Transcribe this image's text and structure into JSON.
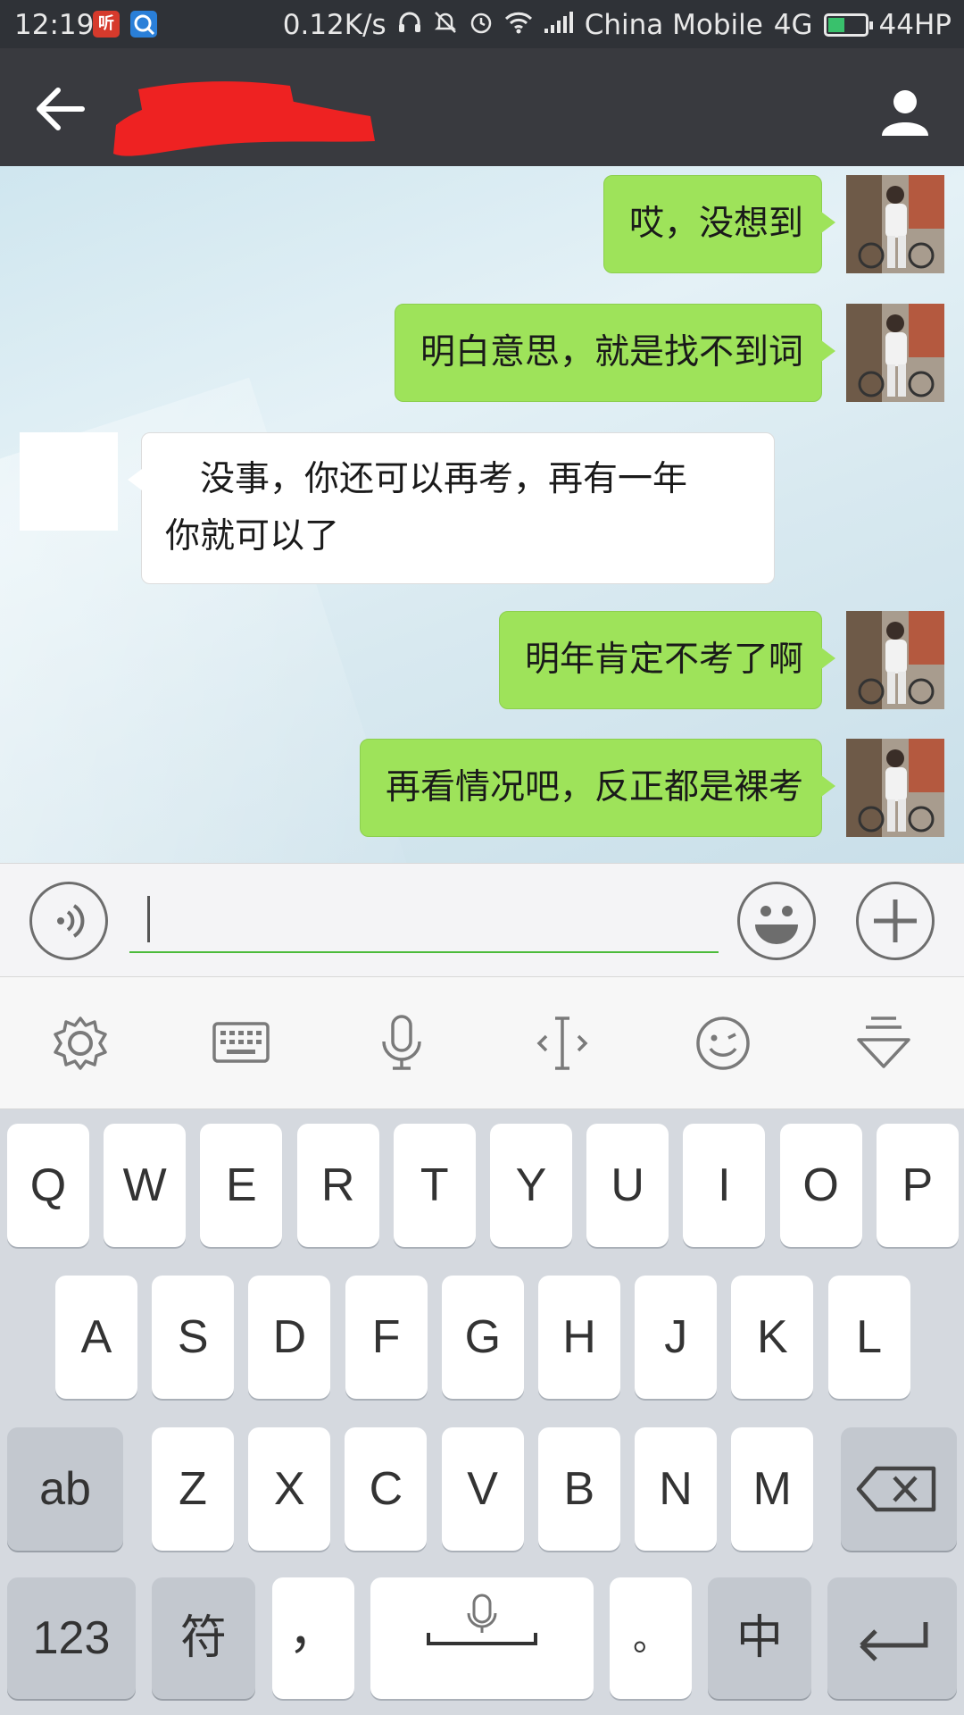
{
  "status_bar": {
    "time": "12:19",
    "app_icon_1": "听",
    "speed": "0.12K/s",
    "carrier": "China Mobile",
    "network": "4G",
    "battery_label": "44HP",
    "battery_level_fraction": 0.44,
    "battery_color": "#39c16c",
    "icons": [
      "headphones-icon",
      "mute-icon",
      "alarm-icon",
      "wifi-icon",
      "signal-icon"
    ]
  },
  "header": {
    "title": "",
    "background": "#393a3f"
  },
  "messages": [
    {
      "side": "me",
      "text": "哎，没想到"
    },
    {
      "side": "me",
      "text": "明白意思，就是找不到词"
    },
    {
      "side": "other",
      "lines": [
        "　没事，你还可以再考，再有一年",
        "你就可以了"
      ]
    },
    {
      "side": "me",
      "text": "明年肯定不考了啊"
    },
    {
      "side": "me",
      "text": "再看情况吧，反正都是裸考"
    }
  ],
  "input": {
    "value": "",
    "placeholder": "",
    "accent": "#4cbb3a"
  },
  "keyboard": {
    "row1": [
      "Q",
      "W",
      "E",
      "R",
      "T",
      "Y",
      "U",
      "I",
      "O",
      "P"
    ],
    "row2": [
      "A",
      "S",
      "D",
      "F",
      "G",
      "H",
      "J",
      "K",
      "L"
    ],
    "row3_left": "ab",
    "row3": [
      "Z",
      "X",
      "C",
      "V",
      "B",
      "N",
      "M"
    ],
    "row4": {
      "num": "123",
      "symbol": "符",
      "comma": "，",
      "period": "。",
      "lang": "中"
    }
  },
  "colors": {
    "bubble_me": "#9ee35a",
    "bubble_other": "#ffffff"
  }
}
